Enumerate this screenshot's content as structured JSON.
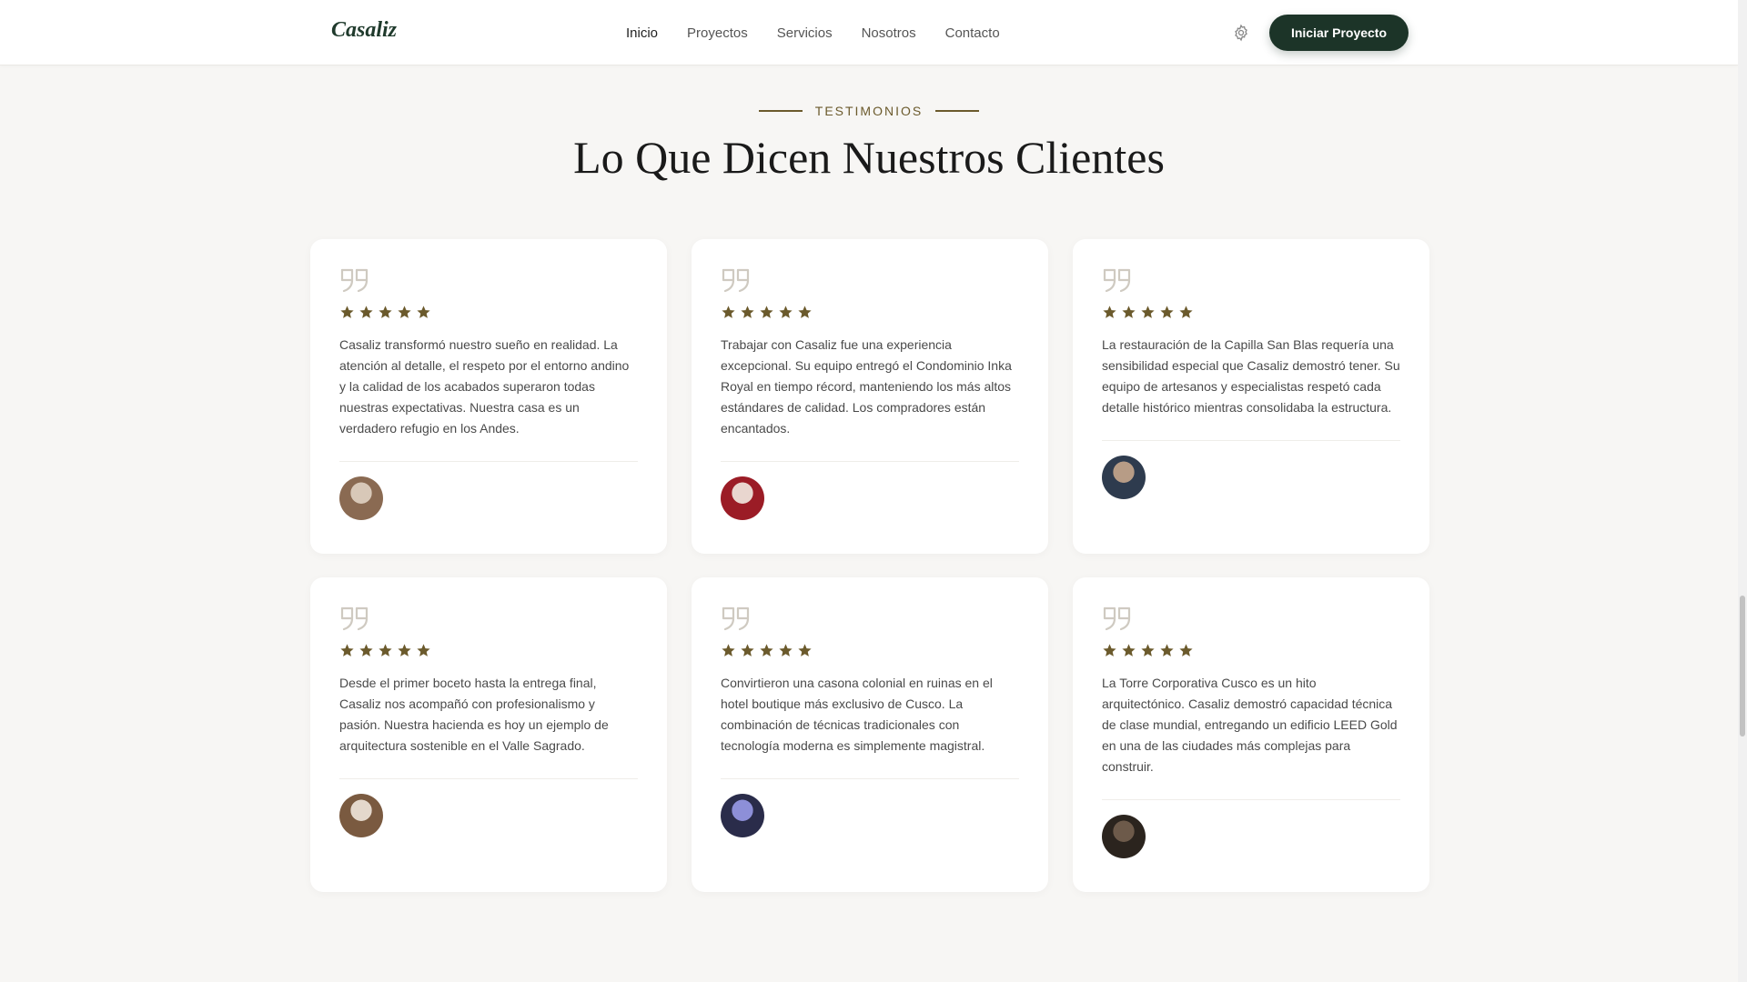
{
  "header": {
    "logo": "Casaliz",
    "nav": [
      "Inicio",
      "Proyectos",
      "Servicios",
      "Nosotros",
      "Contacto"
    ],
    "active_nav": "Inicio",
    "cta_label": "Iniciar Proyecto",
    "settings_icon": "gear-icon"
  },
  "section": {
    "eyebrow": "TESTIMONIOS",
    "title": "Lo Que Dicen Nuestros Clientes"
  },
  "colors": {
    "brand_dark": "#1c3428",
    "accent": "#6b5a2c",
    "star": "#6b5a2c",
    "quote_icon": "#cfcac1",
    "background": "#f7f6f4"
  },
  "testimonials": [
    {
      "rating": 5,
      "text": "Casaliz transformó nuestro sueño en realidad. La atención al detalle, el respeto por el entorno andino y la calidad de los acabados superaron todas nuestras expectativas. Nuestra casa es un verdadero refugio en los Andes.",
      "name": "",
      "role": "",
      "avatar_colors": [
        "#8a6a52",
        "#d8c8b8"
      ]
    },
    {
      "rating": 5,
      "text": "Trabajar con Casaliz fue una experiencia excepcional. Su equipo entregó el Condominio Inka Royal en tiempo récord, manteniendo los más altos estándares de calidad. Los compradores están encantados.",
      "name": "",
      "role": "",
      "avatar_colors": [
        "#9b1c26",
        "#e9d6cf"
      ]
    },
    {
      "rating": 5,
      "text": "La restauración de la Capilla San Blas requería una sensibilidad especial que Casaliz demostró tener. Su equipo de artesanos y especialistas respetó cada detalle histórico mientras consolidaba la estructura.",
      "name": "",
      "role": "",
      "avatar_colors": [
        "#2e3b4e",
        "#b79c86"
      ]
    },
    {
      "rating": 5,
      "text": "Desde el primer boceto hasta la entrega final, Casaliz nos acompañó con profesionalismo y pasión. Nuestra hacienda es hoy un ejemplo de arquitectura sostenible en el Valle Sagrado.",
      "name": "",
      "role": "",
      "avatar_colors": [
        "#7a5a40",
        "#e4d8cc"
      ]
    },
    {
      "rating": 5,
      "text": "Convirtieron una casona colonial en ruinas en el hotel boutique más exclusivo de Cusco. La combinación de técnicas tradicionales con tecnología moderna es simplemente magistral.",
      "name": "",
      "role": "",
      "avatar_colors": [
        "#2a2c4a",
        "#8d8fd8"
      ]
    },
    {
      "rating": 5,
      "text": "La Torre Corporativa Cusco es un hito arquitectónico. Casaliz demostró capacidad técnica de clase mundial, entregando un edificio LEED Gold en una de las ciudades más complejas para construir.",
      "name": "",
      "role": "",
      "avatar_colors": [
        "#2b241e",
        "#6d5a4a"
      ]
    }
  ]
}
